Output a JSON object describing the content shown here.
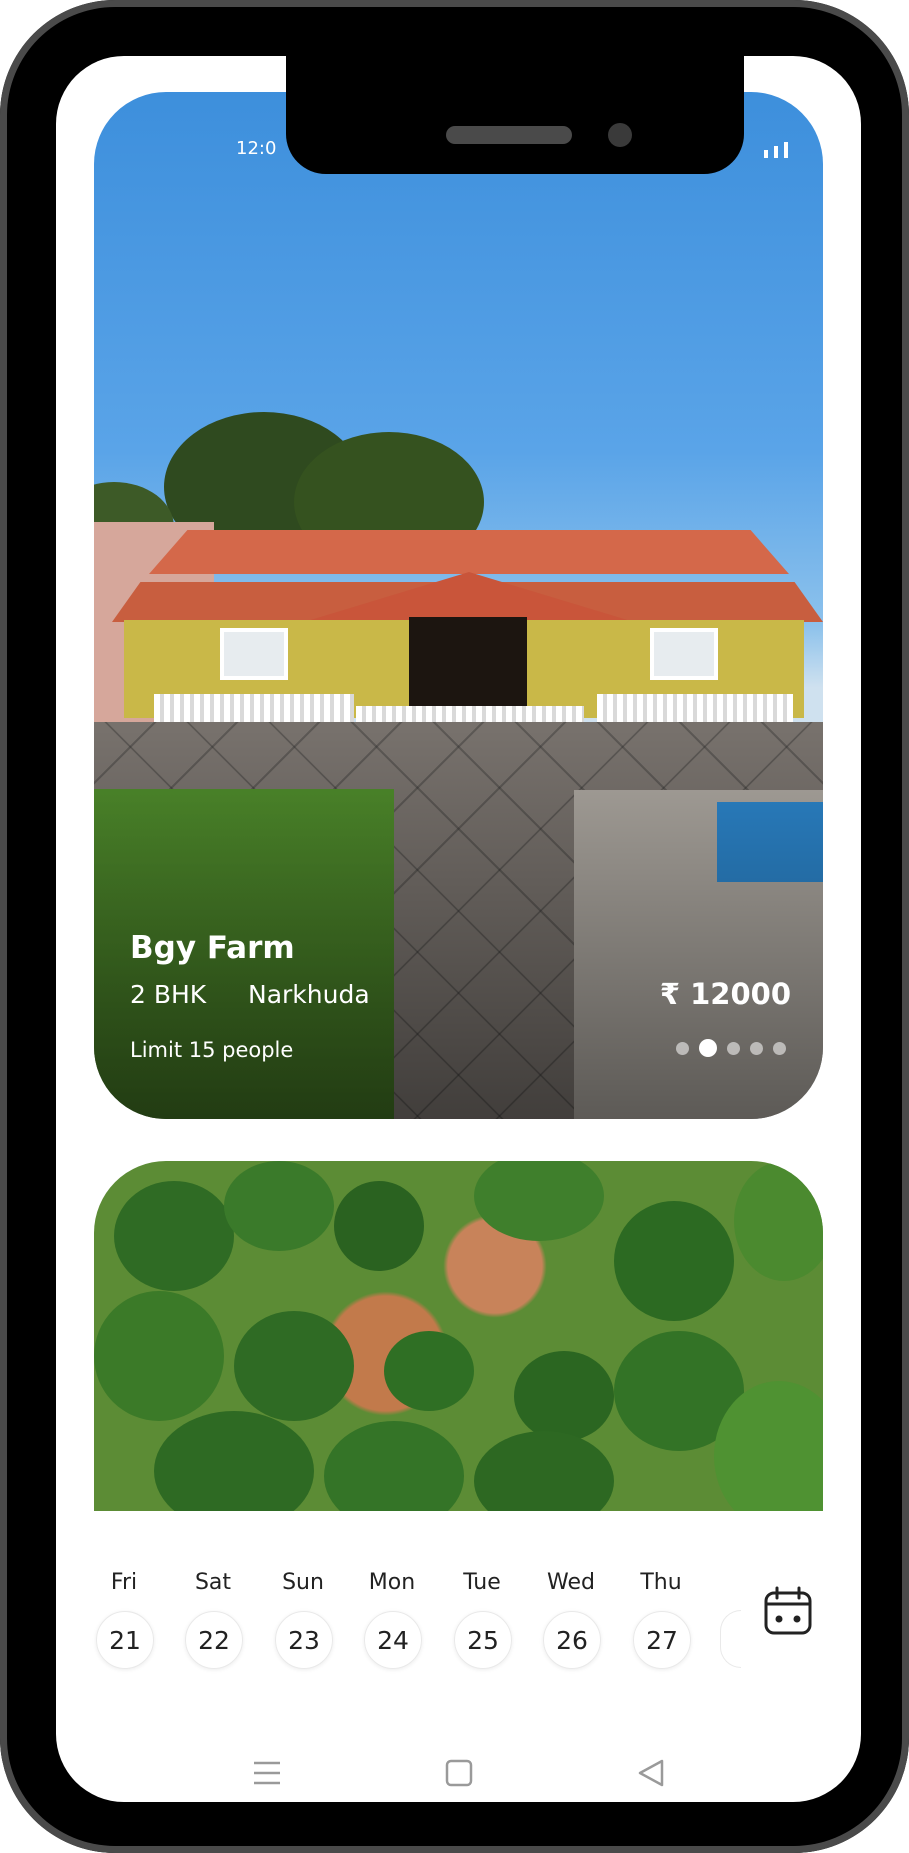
{
  "status_bar": {
    "time": "12:0",
    "signal": "signal"
  },
  "listing": {
    "name": "Bgy Farm",
    "type": "2 BHK",
    "location": "Narkhuda",
    "price": "₹ 12000",
    "limit": "Limit 15 people",
    "image_count": 5,
    "active_image_index": 1
  },
  "calendar": {
    "days": [
      {
        "name": "Fri",
        "date": "21"
      },
      {
        "name": "Sat",
        "date": "22"
      },
      {
        "name": "Sun",
        "date": "23"
      },
      {
        "name": "Mon",
        "date": "24"
      },
      {
        "name": "Tue",
        "date": "25"
      },
      {
        "name": "Wed",
        "date": "26"
      },
      {
        "name": "Thu",
        "date": "27"
      }
    ],
    "icon": "calendar-icon"
  },
  "nav_bar": {
    "menu_icon": "menu-icon",
    "home_icon": "home-icon",
    "back_icon": "back-icon"
  }
}
